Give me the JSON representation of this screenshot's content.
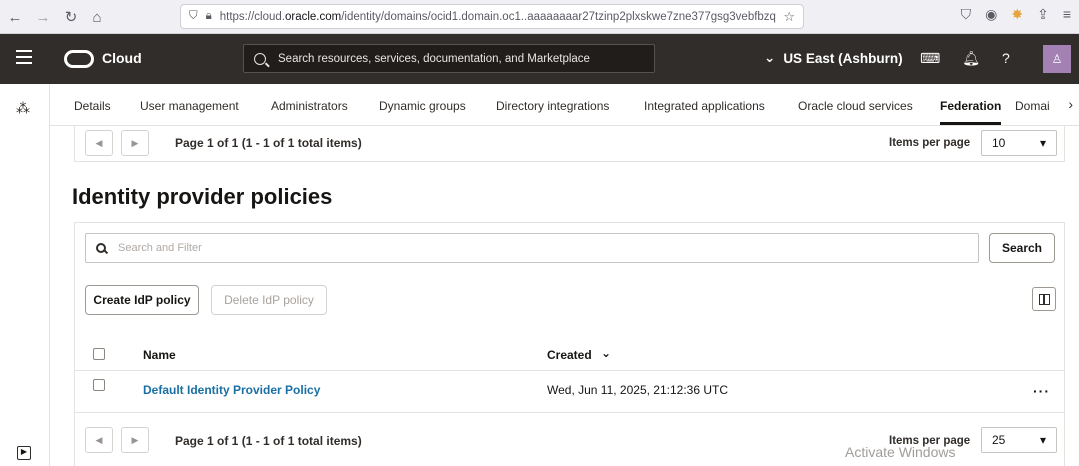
{
  "browser": {
    "url_prefix": "https://cloud.",
    "url_domain": "oracle.com",
    "url_rest": "/identity/domains/ocid1.domain.oc1..aaaaaaaar27tzinp2plxskwe7zne377gsg3vebfbzq"
  },
  "header": {
    "brand": "Cloud",
    "search_text": "Search resources, services, documentation, and Marketplace",
    "region": "US East (Ashburn)"
  },
  "tabs": [
    {
      "label": "Details"
    },
    {
      "label": "User management"
    },
    {
      "label": "Administrators"
    },
    {
      "label": "Dynamic groups"
    },
    {
      "label": "Directory integrations"
    },
    {
      "label": "Integrated applications"
    },
    {
      "label": "Oracle cloud services"
    },
    {
      "label": "Federation"
    },
    {
      "label": "Domai"
    }
  ],
  "top_pager": {
    "text": "Page 1 of 1 (1 - 1 of 1 total items)",
    "items_label": "Items per page",
    "items_value": "10"
  },
  "section": {
    "title": "Identity provider policies",
    "filter_placeholder": "Search and Filter",
    "search_button": "Search",
    "create_button": "Create IdP policy",
    "delete_button": "Delete IdP policy"
  },
  "table": {
    "col_name": "Name",
    "col_created": "Created",
    "rows": [
      {
        "name": "Default Identity Provider Policy",
        "created": "Wed, Jun 11, 2025, 21:12:36 UTC"
      }
    ]
  },
  "bottom_pager": {
    "text": "Page 1 of 1 (1 - 1 of 1 total items)",
    "items_label": "Items per page",
    "items_value": "25"
  },
  "watermark": "Activate Windows"
}
